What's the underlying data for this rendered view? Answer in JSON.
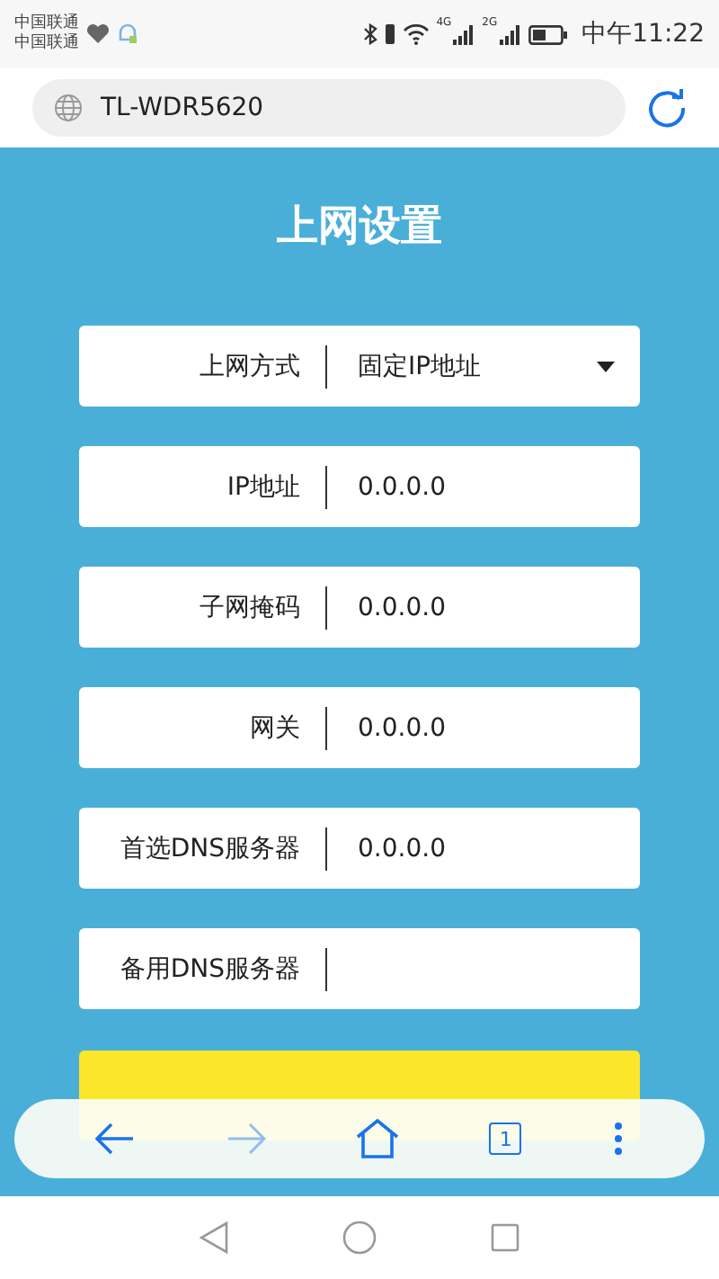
{
  "status_bar": {
    "carriers": [
      "中国联通",
      "中国联通"
    ],
    "network_labels": [
      "4G",
      "2G"
    ],
    "time": "中午11:22"
  },
  "address_bar": {
    "url": "TL-WDR5620"
  },
  "page": {
    "title": "上网设置",
    "fields": [
      {
        "kind": "select",
        "label": "上网方式",
        "value": "固定IP地址"
      },
      {
        "kind": "input",
        "label": "IP地址",
        "value": "0.0.0.0"
      },
      {
        "kind": "input",
        "label": "子网掩码",
        "value": "0.0.0.0"
      },
      {
        "kind": "input",
        "label": "网关",
        "value": "0.0.0.0"
      },
      {
        "kind": "input",
        "label": "首选DNS服务器",
        "value": "0.0.0.0"
      },
      {
        "kind": "input",
        "label": "备用DNS服务器"
      }
    ],
    "next_button": {
      "kind": "primary"
    }
  },
  "browser_toolbar": {
    "tab_count": "1",
    "forward_disabled": true
  }
}
